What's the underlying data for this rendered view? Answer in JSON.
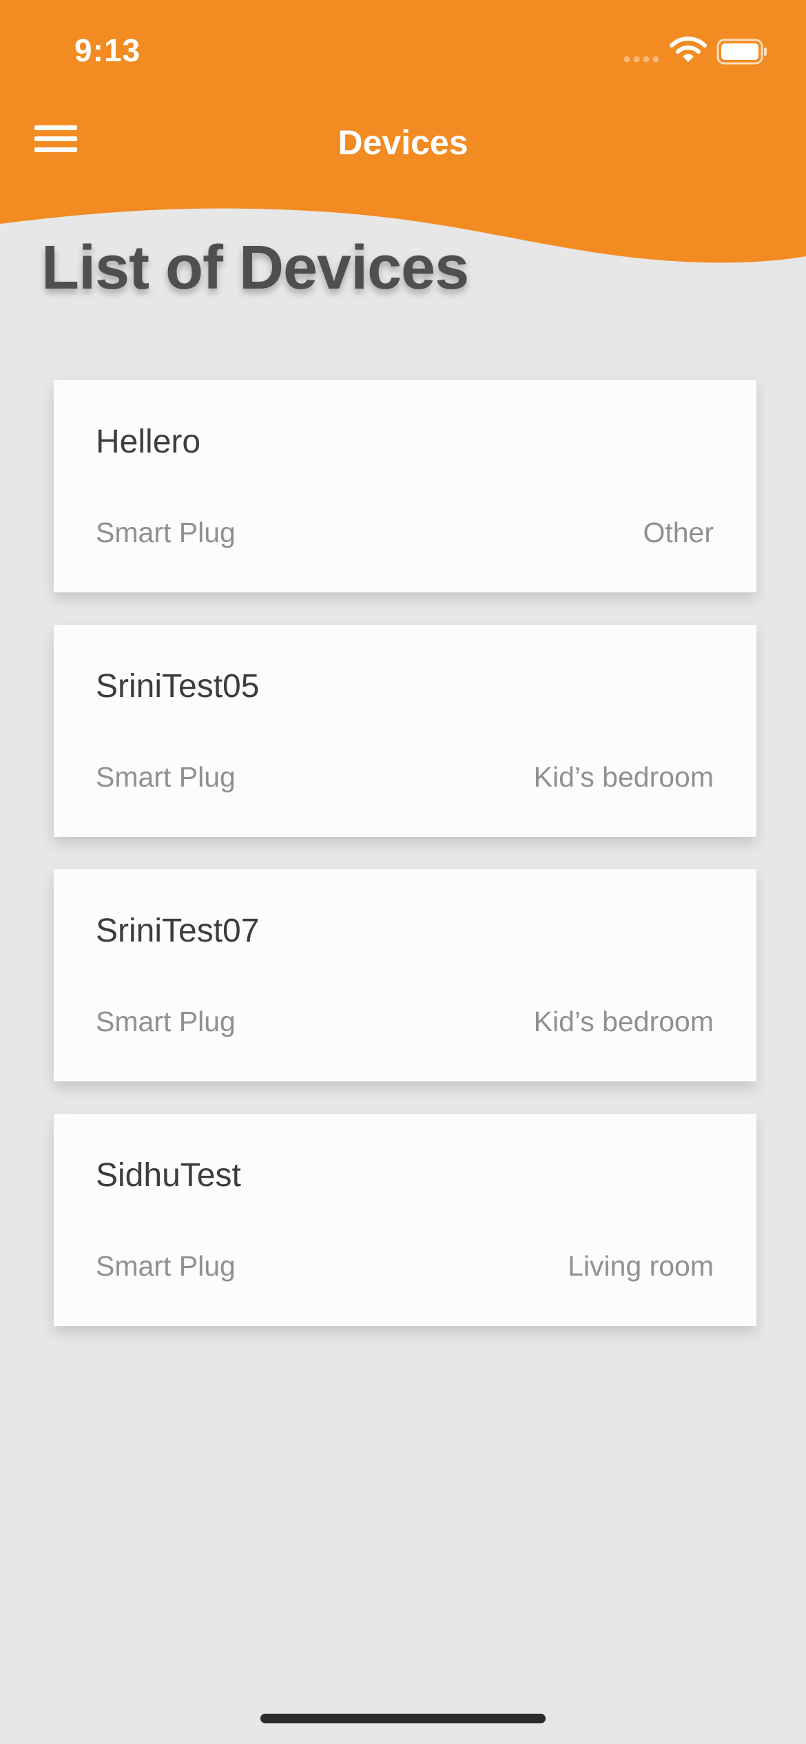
{
  "status_bar": {
    "time": "9:13"
  },
  "nav": {
    "title": "Devices",
    "menu_icon": "hamburger-menu-icon"
  },
  "page": {
    "title": "List of Devices"
  },
  "devices": [
    {
      "name": "Hellero",
      "type": "Smart Plug",
      "room": "Other"
    },
    {
      "name": "SriniTest05",
      "type": "Smart Plug",
      "room": "Kid’s bedroom"
    },
    {
      "name": "SriniTest07",
      "type": "Smart Plug",
      "room": "Kid’s bedroom"
    },
    {
      "name": "SidhuTest",
      "type": "Smart Plug",
      "room": "Living room"
    }
  ],
  "colors": {
    "header": "#f18b22",
    "background": "#e7e7e7",
    "card": "#fcfcfc",
    "title_text": "#4f4f4f",
    "secondary_text": "#909090"
  }
}
